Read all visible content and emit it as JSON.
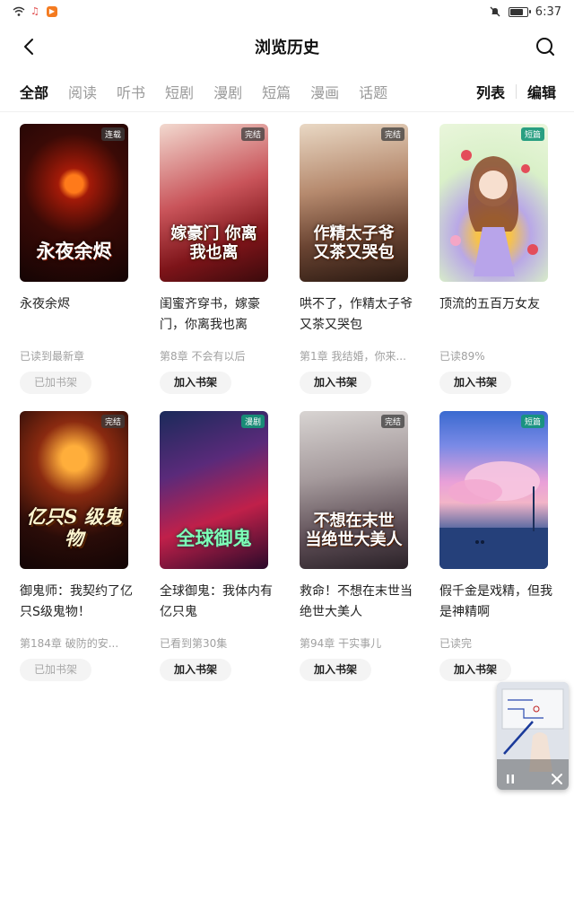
{
  "status_bar": {
    "time": "6:37",
    "battery_level": 0.85
  },
  "header": {
    "title": "浏览历史"
  },
  "tabs": [
    {
      "label": "全部",
      "active": true
    },
    {
      "label": "阅读"
    },
    {
      "label": "听书"
    },
    {
      "label": "短剧"
    },
    {
      "label": "漫剧"
    },
    {
      "label": "短篇"
    },
    {
      "label": "漫画"
    },
    {
      "label": "话题"
    }
  ],
  "actions": {
    "list": "列表",
    "edit": "编辑"
  },
  "books": [
    {
      "badge": "连载",
      "cover_text": "永夜余烬",
      "title": "永夜余烬",
      "progress": "已读到最新章",
      "button": "已加书架",
      "added": true
    },
    {
      "badge": "完结",
      "cover_text": "嫁豪门 你离我也离",
      "title": "闺蜜齐穿书，嫁豪门，你离我也离",
      "progress": "第8章 不会有以后",
      "button": "加入书架",
      "added": false
    },
    {
      "badge": "完结",
      "cover_text": "作精太子爷 又茶又哭包",
      "title": "哄不了，作精太子爷又茶又哭包",
      "progress": "第1章 我结婚，你来...",
      "button": "加入书架",
      "added": false
    },
    {
      "badge": "短篇",
      "cover_text": "",
      "title": "顶流的五百万女友",
      "progress": "已读89%",
      "button": "加入书架",
      "added": false
    },
    {
      "badge": "完结",
      "cover_text": "亿只S 级鬼物",
      "title": "御鬼师：我契约了亿只S级鬼物！",
      "progress": "第184章 破防的安...",
      "button": "已加书架",
      "added": true
    },
    {
      "badge": "漫剧",
      "cover_text": "全球御鬼",
      "title": "全球御鬼：我体内有亿只鬼",
      "progress": "已看到第30集",
      "button": "加入书架",
      "added": false
    },
    {
      "badge": "完结",
      "cover_text": "不想在末世 当绝世大美人",
      "title": "救命！不想在末世当绝世大美人",
      "progress": "第94章 干实事儿",
      "button": "加入书架",
      "added": false
    },
    {
      "badge": "短篇",
      "cover_text": "",
      "title": "假千金是戏精，但我是神精啊",
      "progress": "已读完",
      "button": "加入书架",
      "added": false
    }
  ],
  "colors": {
    "accent_text": "#111111",
    "muted_text": "#9a9a9a",
    "badge_teal": "#149678"
  }
}
